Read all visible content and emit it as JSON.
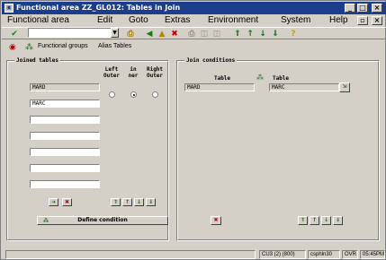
{
  "window": {
    "title": "Functional area ZZ_GL012: Tables in Join"
  },
  "menubar": {
    "items": [
      "Functional area",
      "Edit",
      "Goto",
      "Extras",
      "Environment",
      "System",
      "Help"
    ]
  },
  "toolbar": {
    "command_field_value": ""
  },
  "app_toolbar": {
    "functional_groups_label": "Functional groups",
    "alias_tables_label": "Alias Tables"
  },
  "joined_tables": {
    "title": "Joined tables",
    "headers": {
      "left_outer": "Left Outer",
      "inner": "in ner",
      "right_outer": "Right Outer"
    },
    "tables": [
      "MARD",
      "MARC",
      "",
      "",
      "",
      "",
      ""
    ],
    "selected_join": "inner"
  },
  "join_conditions": {
    "title": "Join conditions",
    "col_table_left": "Table",
    "col_table_right": "Table",
    "rows": [
      {
        "left": "MARD",
        "right": "MARC"
      }
    ]
  },
  "define_condition_button": "Define condition",
  "statusbar": {
    "system": "CU3 (2) (800)",
    "server": "csphln30",
    "mode": "OVR",
    "time": "05:45PM"
  },
  "colors": {
    "title_bar": "#1c3c8c",
    "window_bg": "#d4d0c8"
  }
}
